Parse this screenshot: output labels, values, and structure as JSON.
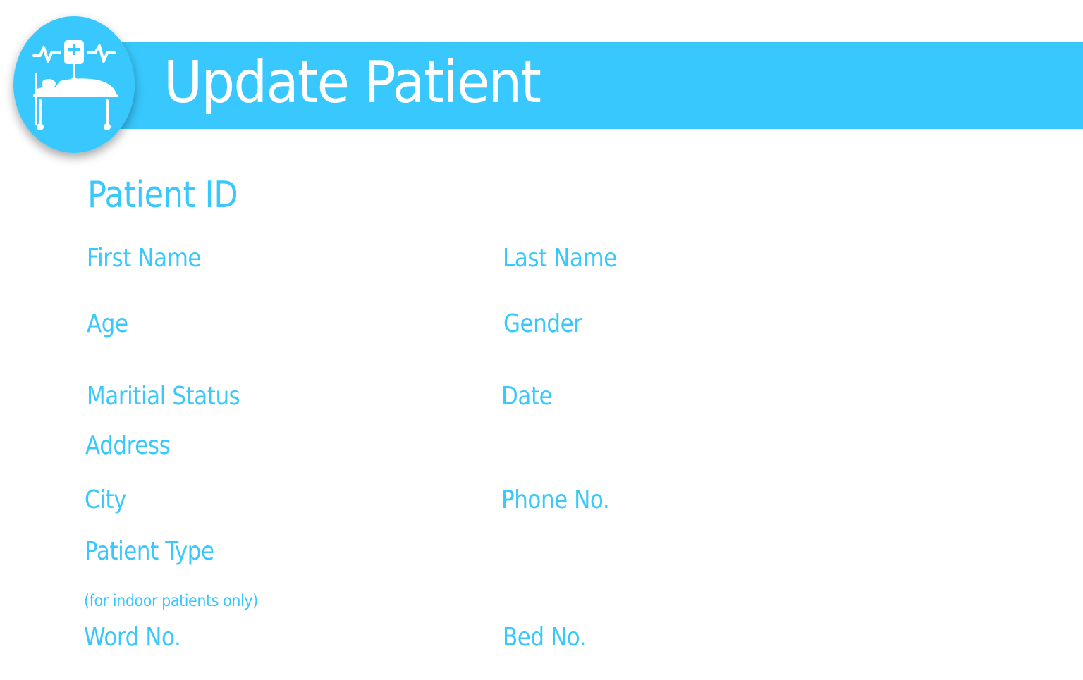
{
  "colors": {
    "accent": "#38c8fd",
    "label": "#38c8fd",
    "title_text": "#ffffff",
    "background": "#ffffff"
  },
  "header": {
    "title": "Update Patient",
    "logo_icon": "hospital-bed-iv-drip-icon"
  },
  "form": {
    "patient_id_label": "Patient ID",
    "first_name_label": "First Name",
    "last_name_label": "Last Name",
    "age_label": "Age",
    "gender_label": "Gender",
    "marital_status_label": "Maritial Status",
    "date_label": "Date",
    "address_label": "Address",
    "city_label": "City",
    "phone_label": "Phone No.",
    "patient_type_label": "Patient Type",
    "indoor_note": "(for indoor patients only)",
    "ward_no_label": "Word No.",
    "bed_no_label": "Bed No."
  }
}
